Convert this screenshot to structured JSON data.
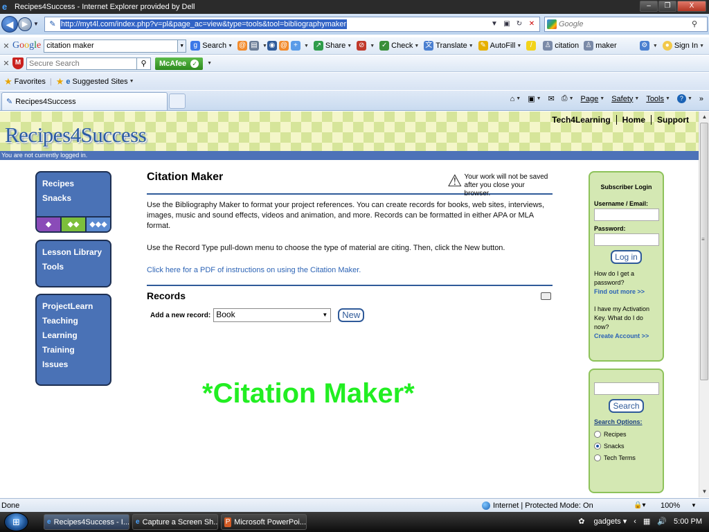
{
  "window": {
    "title": "Recipes4Success - Internet Explorer provided by Dell",
    "buttons": [
      "–",
      "❐",
      "X"
    ]
  },
  "address_bar": {
    "url": "http://myt4l.com/index.php?v=pl&page_ac=view&type=tools&tool=bibliographymaker",
    "search_placeholder": "Google"
  },
  "google_toolbar": {
    "logo": [
      "G",
      "o",
      "o",
      "g",
      "l",
      "e"
    ],
    "query": "citation maker",
    "items": [
      "Search",
      "Share",
      "Check",
      "Translate",
      "AutoFill",
      "citation",
      "maker"
    ],
    "sign_in": "Sign In"
  },
  "mcafee_bar": {
    "search_placeholder": "Secure Search",
    "brand": "McAfee"
  },
  "favorites_bar": {
    "favorites": "Favorites",
    "suggested": "Suggested Sites"
  },
  "tab": {
    "label": "Recipes4Success"
  },
  "command_bar": {
    "page": "Page",
    "safety": "Safety",
    "tools": "Tools"
  },
  "site": {
    "logo": "Recipes4Success",
    "links": [
      "Tech4Learning",
      "Home",
      "Support"
    ],
    "login_status": "You are not currently logged in."
  },
  "left_nav": {
    "box1": [
      "Recipes",
      "Snacks"
    ],
    "box2": [
      "Lesson Library",
      "Tools"
    ],
    "box3": [
      "ProjectLearn",
      "Teaching",
      "Learning",
      "Training",
      "Issues"
    ]
  },
  "main": {
    "title": "Citation Maker",
    "warning_line1": "Your work will not be saved",
    "warning_line2": "after you close your browser.",
    "para1": "Use the Bibliography Maker to format your project references. You can create records for books, web sites, interviews, images, music and sound effects, videos and animation, and more. Records can be formatted in either APA or MLA format.",
    "para2": "Use the Record Type pull-down menu to choose the type of material are citing. Then, click the New button.",
    "pdf_link": "Click here for a PDF of instructions on using the Citation Maker.",
    "records_heading": "Records",
    "add_label": "Add a new record:",
    "record_type": "Book",
    "new_button": "New"
  },
  "overlay_title": "*Citation Maker*",
  "login_panel": {
    "title": "Subscriber Login",
    "username_label": "Username / Email:",
    "password_label": "Password:",
    "login_button": "Log in",
    "help_text": "How do I get a password?",
    "find_out_more": "Find out more >>",
    "activation_text": "I have my Activation Key. What do I do now?",
    "create_account": "Create Account >>"
  },
  "search_panel": {
    "search_button": "Search",
    "options_label": "Search Options:",
    "options": [
      "Recipes",
      "Snacks",
      "Tech Terms"
    ],
    "selected": "Snacks"
  },
  "status_bar": {
    "status": "Done",
    "zone": "Internet | Protected Mode: On",
    "zoom": "100%"
  },
  "taskbar": {
    "tasks": [
      "Recipes4Success - I...",
      "Capture a Screen Sh...",
      "Microsoft PowerPoi..."
    ],
    "gadgets": "gadgets",
    "time": "5:00 PM"
  },
  "colors": {
    "nav_box": "#4a72b6",
    "site_bar": "#4d72b8",
    "panel_green": "#d4e8b3",
    "overlay_green": "#22ee22",
    "link_blue": "#2c63b5"
  }
}
